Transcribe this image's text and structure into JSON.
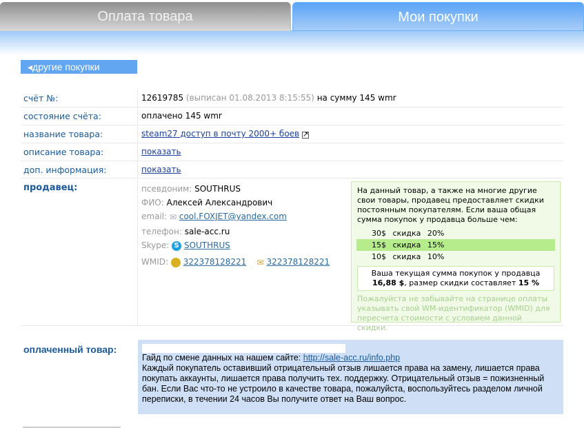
{
  "tabs": [
    {
      "label": "Оплата товара"
    },
    {
      "label": "Мои покупки"
    }
  ],
  "back_button": "другие покупки",
  "rows": {
    "invoice": {
      "label": "счёт №:",
      "number": "12619785",
      "issued": "(выписан 01.08.2013 8:15:55)",
      "amount": "на сумму 145 wmr"
    },
    "status": {
      "label": "состояние счёта:",
      "value": "оплачено 145 wmr"
    },
    "product": {
      "label": "название товара:",
      "value": "steam27 доступ в почту 2000+ боев"
    },
    "description": {
      "label": "описание товара:",
      "value": "показать"
    },
    "extra": {
      "label": "доп. информация:",
      "value": "показать"
    }
  },
  "seller": {
    "label": "продавец:",
    "nick_label": "псевдоним:",
    "nick": "SOUTHRUS",
    "fio_label": "ФИО:",
    "fio": "Алексей Александрович",
    "email_label": "email:",
    "email": "cool.FOXJET@yandex.com",
    "phone_label": "телефон:",
    "phone": "sale-acc.ru",
    "skype_label": "Skype:",
    "skype": "SOUTHRUS",
    "wmid_label": "WMID:",
    "wmid": "322378128221",
    "wmid_msg": "322378128221"
  },
  "discount": {
    "intro": "На данный товар, а также на многие другие свои товары, продавец предоставляет скидки постоянным покупателям. Если ваша общая сумма покупок у продавца больше чем:",
    "levels": [
      {
        "sum": "30$",
        "word": "скидка",
        "pct": "20%"
      },
      {
        "sum": "15$",
        "word": "скидка",
        "pct": "15%"
      },
      {
        "sum": "10$",
        "word": "скидка",
        "pct": "10%"
      }
    ],
    "current_text1": "Ваша текущая сумма покупок у продавца",
    "current_sum": "16,88 $",
    "current_text2": ", размер скидки составляет ",
    "current_pct": "15 %",
    "note": "Пожалуйста не забывайте на странице оплаты указывать свой WM-идентификатор (WMID) для пересчета стоимости с условием данной скидки."
  },
  "paid": {
    "label": "оплаченный товар:",
    "guide": "Гайд по смене данных на нашем сайте: ",
    "guide_link": "http://sale-acc.ru/info.php",
    "text": "Каждый покупатель оставивший отрицательный отзыв лишается права на замену, лишается права покупать аккаунты, лишается права получить тех. поддержку. Отрицательный отзыв = пожизненный бан. Если Вас что-то не устроило в качестве товара, пожалуйста, воспользуйтесь разделом личной переписки, в течении 24 часов Вы получите ответ на Ваш вопрос."
  }
}
